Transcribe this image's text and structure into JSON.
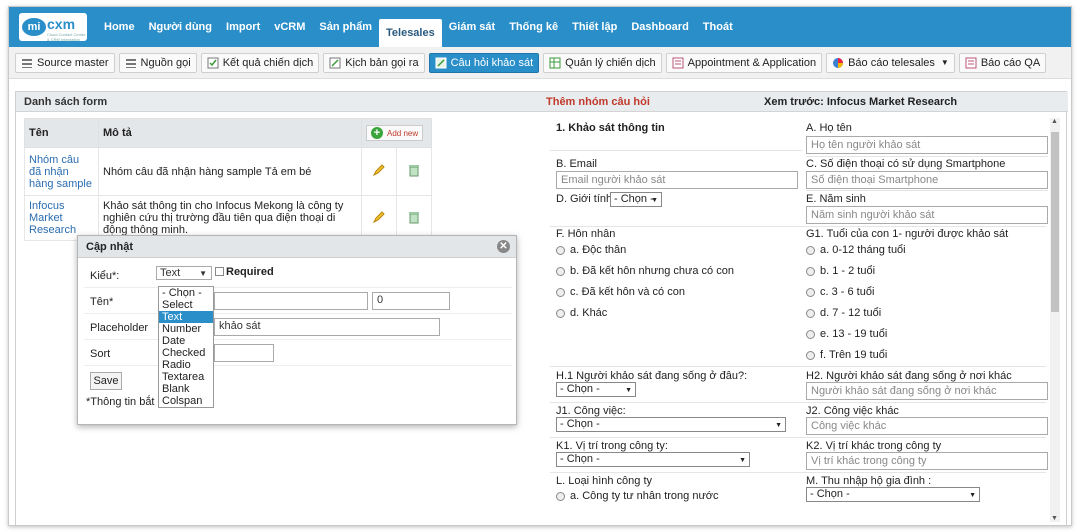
{
  "app": {
    "logo_mi": "mi",
    "logo_cxm": "cxm",
    "logo_tag": "Cloud Contact Center & CRM Integration"
  },
  "nav": {
    "items": [
      "Home",
      "Người dùng",
      "Import",
      "vCRM",
      "Sản phẩm",
      "Telesales",
      "Giám sát",
      "Thống kê",
      "Thiết lập",
      "Dashboard",
      "Thoát"
    ],
    "active": "Telesales"
  },
  "toolbar": {
    "items": [
      "Source master",
      "Nguồn gọi",
      "Kết quả chiến dịch",
      "Kịch bản gọi ra",
      "Câu hỏi khảo sát",
      "Quản lý chiến dịch",
      "Appointment & Application",
      "Báo cáo telesales",
      "Báo cáo QA"
    ],
    "active": "Câu hỏi khảo sát"
  },
  "left": {
    "header": "Danh sách form",
    "columns": {
      "name": "Tên",
      "desc": "Mô tả"
    },
    "add_new": "Add new",
    "rows": [
      {
        "name": "Nhóm câu đã nhận hàng sample",
        "desc": "Nhóm câu đã nhận hàng sample Tả em bé"
      },
      {
        "name": "Infocus Market Research",
        "desc": "Khảo sát thông tin cho Infocus Mekong là công ty nghiên cứu thị trường đầu tiên qua điện thoại di động thông minh."
      }
    ]
  },
  "dialog": {
    "title": "Cập nhật",
    "labels": {
      "type": "Kiểu*:",
      "name": "Tên*",
      "placeholder": "Placeholder",
      "sort": "Sort"
    },
    "type_value": "Text",
    "required_label": "Required",
    "name_value2": "0",
    "placeholder_value": "khảo sát",
    "save": "Save",
    "note": "*Thông tin bắt bu",
    "type_options": [
      "- Chọn -",
      "Select",
      "Text",
      "Number",
      "Date",
      "Checked",
      "Radio",
      "Textarea",
      "Blank",
      "Colspan"
    ]
  },
  "right": {
    "add_group": "Thêm nhóm câu hỏi",
    "preview": "Xem trước: Infocus Market Research",
    "q1": "1. Khảo sát thông tin",
    "qa": "A. Họ tên",
    "qa_ph": "Họ tên người khảo sát",
    "qb": "B. Email",
    "qb_ph": "Email người khảo sát",
    "qc": "C. Số điện thoại có sử dụng Smartphone",
    "qc_ph": "Số điện thoại Smartphone",
    "qd": "D. Giới tính:",
    "choose": "- Chọn -",
    "qe": "E. Năm sinh",
    "qe_ph": "Năm sinh người khảo sát",
    "qf": "F. Hôn nhân",
    "qf_opts": [
      "a. Độc thân",
      "b. Đã kết hôn nhưng chưa có con",
      "c. Đã kết hôn và có con",
      "d. Khác"
    ],
    "qg": "G1. Tuổi của con 1- người được khảo sát",
    "qg_opts": [
      "a. 0-12 tháng tuổi",
      "b. 1 - 2 tuổi",
      "c. 3 - 6 tuổi",
      "d. 7 - 12 tuổi",
      "e. 13 - 19 tuổi",
      "f. Trên 19 tuổi"
    ],
    "qh1": "H.1 Người khảo sát đang sống ở đâu?:",
    "qh2": "H2. Người khảo sát đang sống ở nơi khác",
    "qh2_ph": "Người khảo sát đang sống ở nơi khác",
    "qj1": "J1. Công việc:",
    "qj2": "J2. Công việc khác",
    "qj2_ph": "Công việc khác",
    "qk1": "K1. Vị trí trong công ty:",
    "qk2": "K2. Vị trí khác trong công ty",
    "qk2_ph": "Vị trí khác trong công ty",
    "ql": "L. Loại hình công ty",
    "ql_opt": "a. Công ty tư nhân trong nước",
    "qm": "M. Thu nhập hộ gia đình :"
  }
}
